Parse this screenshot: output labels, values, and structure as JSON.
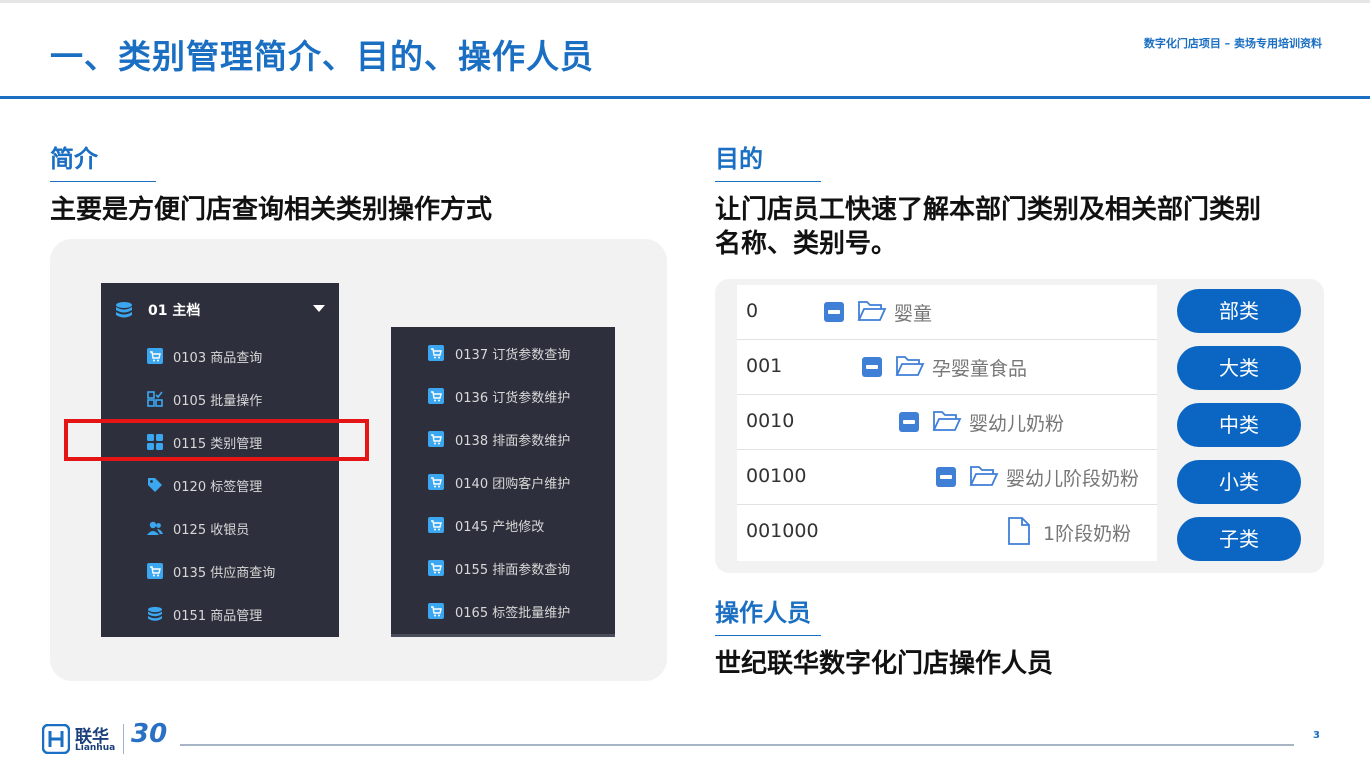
{
  "header": {
    "title": "一、类别管理简介、目的、操作人员",
    "note": "数字化门店项目 – 卖场专用培训资料"
  },
  "intro": {
    "heading": "简介",
    "text": "主要是方便门店查询相关类别操作方式"
  },
  "menu_left": {
    "header_label": "01 主档",
    "items": [
      {
        "label": "0103 商品查询",
        "icon": "cart-icon"
      },
      {
        "label": "0105 批量操作",
        "icon": "batch-icon"
      },
      {
        "label": "0115 类别管理",
        "icon": "grid-icon"
      },
      {
        "label": "0120 标签管理",
        "icon": "tag-icon"
      },
      {
        "label": "0125 收银员",
        "icon": "users-icon"
      },
      {
        "label": "0135 供应商查询",
        "icon": "cart-icon"
      },
      {
        "label": "0151 商品管理",
        "icon": "database-icon"
      }
    ]
  },
  "menu_right": {
    "items": [
      {
        "label": "0137 订货参数查询",
        "icon": "cart-icon"
      },
      {
        "label": "0136 订货参数维护",
        "icon": "cart-icon"
      },
      {
        "label": "0138 排面参数维护",
        "icon": "cart-icon"
      },
      {
        "label": "0140 团购客户维护",
        "icon": "cart-icon"
      },
      {
        "label": "0145 产地修改",
        "icon": "cart-icon"
      },
      {
        "label": "0155 排面参数查询",
        "icon": "cart-icon"
      },
      {
        "label": "0165 标签批量维护",
        "icon": "cart-icon"
      }
    ]
  },
  "purpose": {
    "heading": "目的",
    "text_line1": "让门店员工快速了解本部门类别及相关部门类别",
    "text_line2": "名称、类别号。"
  },
  "tree": {
    "rows": [
      {
        "code": "0",
        "label": "婴童",
        "type": "folder",
        "level": 0
      },
      {
        "code": "001",
        "label": "孕婴童食品",
        "type": "folder",
        "level": 1
      },
      {
        "code": "0010",
        "label": "婴幼儿奶粉",
        "type": "folder",
        "level": 2
      },
      {
        "code": "00100",
        "label": "婴幼儿阶段奶粉",
        "type": "folder",
        "level": 3
      },
      {
        "code": "001000",
        "label": "1阶段奶粉",
        "type": "file",
        "level": 4
      }
    ]
  },
  "categories": [
    "部类",
    "大类",
    "中类",
    "小类",
    "子类"
  ],
  "operators": {
    "heading": "操作人员",
    "text": "世纪联华数字化门店操作人员"
  },
  "footer": {
    "brand_cn": "联华",
    "brand_en": "Lianhua",
    "anniversary": "30",
    "page_number": "3"
  },
  "colors": {
    "brand_blue": "#1a6fc2",
    "button_blue": "#0a66c2",
    "menu_bg": "#2d303c",
    "highlight_red": "#e51515",
    "icon_blue": "#3ba7f0"
  }
}
